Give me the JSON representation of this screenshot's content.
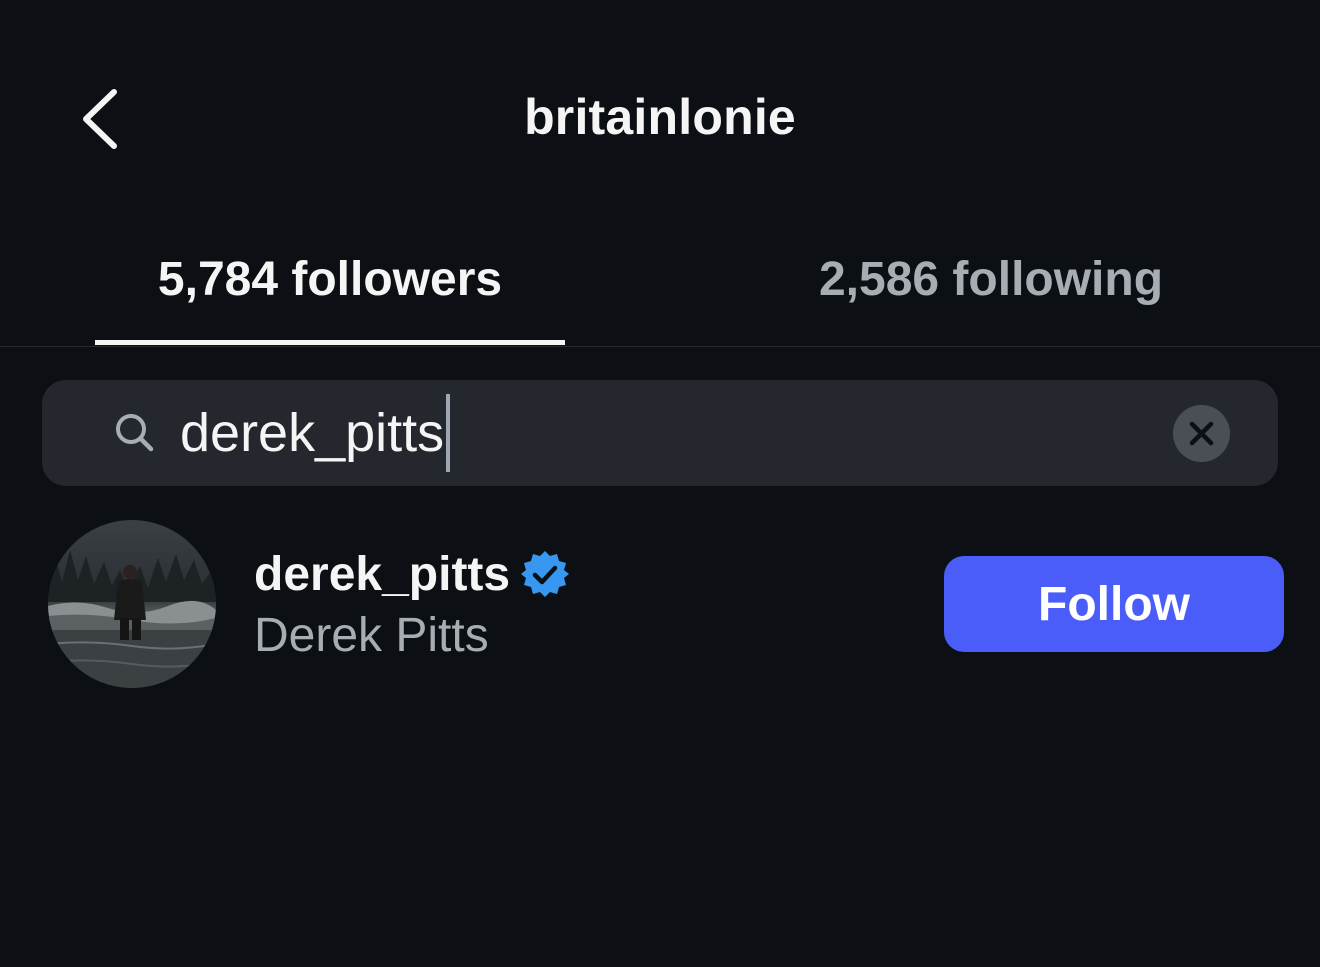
{
  "header": {
    "title": "britainlonie",
    "back_icon": "chevron-left-icon"
  },
  "tabs": [
    {
      "label": "5,784 followers",
      "selected": true
    },
    {
      "label": "2,586 following",
      "selected": false
    }
  ],
  "search": {
    "value": "derek_pitts",
    "icon": "search-icon",
    "clear_icon": "clear-icon"
  },
  "results": [
    {
      "username": "derek_pitts",
      "full_name": "Derek Pitts",
      "verified": true,
      "follow_label": "Follow"
    }
  ],
  "colors": {
    "background": "#0c1014",
    "primary_text": "#f5f5f5",
    "secondary_text": "#a8adb4",
    "search_background": "#24282e",
    "follow_button": "#4a5df9",
    "verified_badge": "#3897f0"
  }
}
